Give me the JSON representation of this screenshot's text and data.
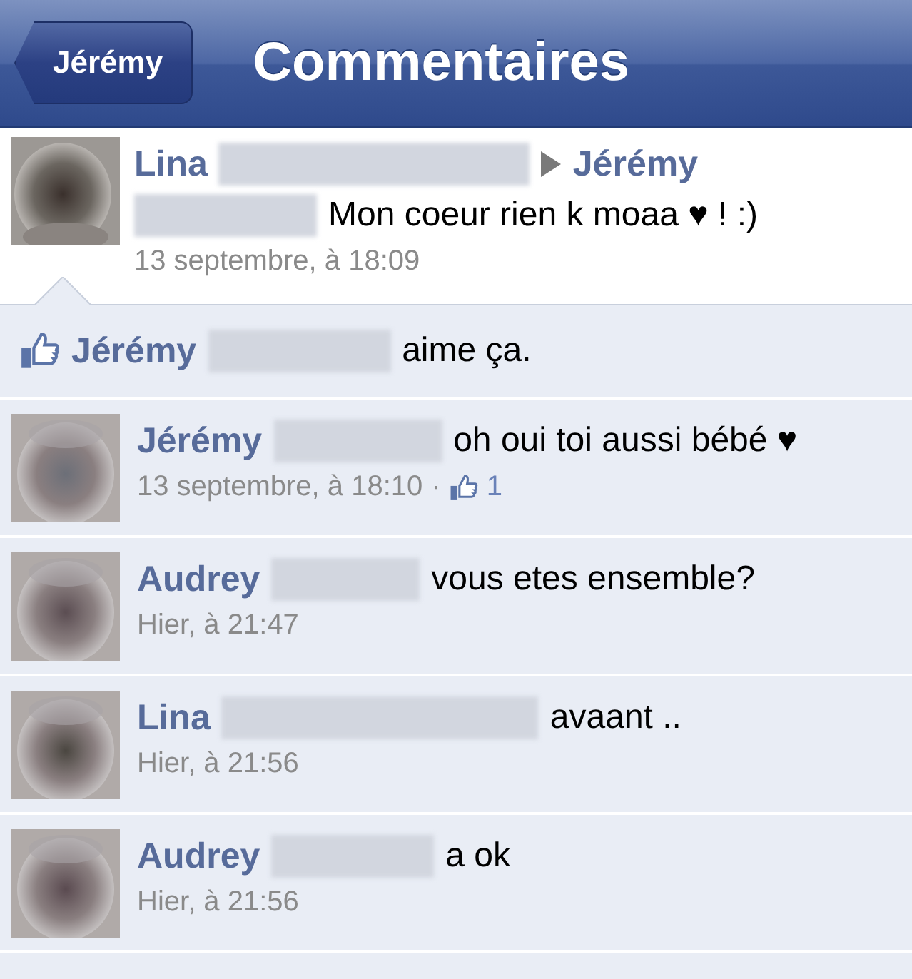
{
  "nav": {
    "back_button": "Jérémy",
    "title": "Commentaires"
  },
  "post": {
    "author": "Lina",
    "recipient": "Jérémy",
    "text": "Mon coeur rien k moaa ♥ ! :)",
    "time": "13 septembre, à 18:09"
  },
  "likes": {
    "name": "Jérémy",
    "text": "aime ça."
  },
  "comments": [
    {
      "author": "Jérémy",
      "text": "oh oui toi aussi bébé ♥",
      "time": "13 septembre, à 18:10",
      "separator": "·",
      "like_count": "1"
    },
    {
      "author": "Audrey",
      "text": "vous etes ensemble?",
      "time": "Hier, à 21:47"
    },
    {
      "author": "Lina",
      "text": "avaant ..",
      "time": "Hier, à 21:56"
    },
    {
      "author": "Audrey",
      "text": "a ok",
      "time": "Hier, à 21:56"
    }
  ]
}
